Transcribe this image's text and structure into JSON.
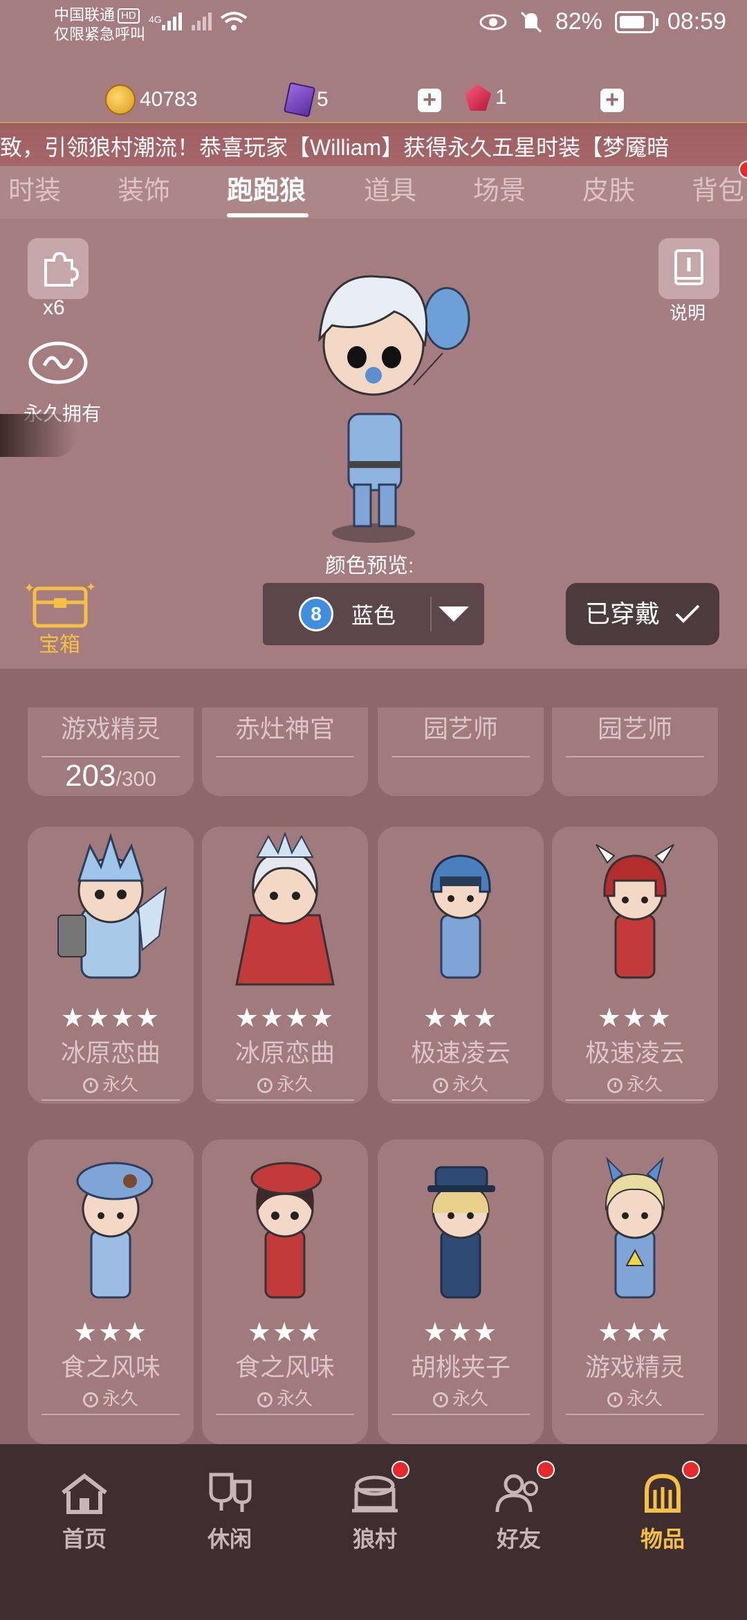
{
  "status_bar": {
    "carrier": "中国联通",
    "hd": "HD",
    "network": "4G",
    "emergency": "仅限紧急呼叫",
    "battery": "82%",
    "time": "08:59"
  },
  "currency": {
    "coins": "40783",
    "tickets": "5",
    "gems": "1"
  },
  "marquee": "致，引领狼村潮流！恭喜玩家【William】获得永久五星时装【梦魇暗",
  "tabs": [
    "时装",
    "装饰",
    "跑跑狼",
    "道具",
    "场景",
    "皮肤",
    "背包"
  ],
  "active_tab": "跑跑狼",
  "preview": {
    "fragments_count": "x6",
    "ownership": "永久拥有",
    "info_label": "说明",
    "color_preview_label": "颜色预览:",
    "color_number": "8",
    "color_name": "蓝色",
    "worn_label": "已穿戴",
    "chest_label": "宝箱"
  },
  "top_cards": [
    {
      "name": "游戏精灵",
      "progress": "203",
      "progress_total": "/300"
    },
    {
      "name": "赤灶神官"
    },
    {
      "name": "园艺师"
    },
    {
      "name": "园艺师"
    }
  ],
  "cards_row1": [
    {
      "name": "冰原恋曲",
      "stars": "★★★★",
      "duration": "永久"
    },
    {
      "name": "冰原恋曲",
      "stars": "★★★★",
      "duration": "永久"
    },
    {
      "name": "极速凌云",
      "stars": "★★★",
      "duration": "永久"
    },
    {
      "name": "极速凌云",
      "stars": "★★★",
      "duration": "永久"
    }
  ],
  "cards_row2": [
    {
      "name": "食之风味",
      "stars": "★★★",
      "duration": "永久"
    },
    {
      "name": "食之风味",
      "stars": "★★★",
      "duration": "永久"
    },
    {
      "name": "胡桃夹子",
      "stars": "★★★",
      "duration": "永久"
    },
    {
      "name": "游戏精灵",
      "stars": "★★★",
      "duration": "永久"
    }
  ],
  "bottom_nav": [
    {
      "label": "首页",
      "icon": "home-icon"
    },
    {
      "label": "休闲",
      "icon": "leisure-icon"
    },
    {
      "label": "狼村",
      "icon": "village-icon"
    },
    {
      "label": "好友",
      "icon": "friends-icon"
    },
    {
      "label": "物品",
      "icon": "items-icon"
    }
  ],
  "colors": {
    "background": "#a57d80",
    "accent_gold": "#f5c043",
    "nav_bg": "#3f2e2f",
    "badge_red": "#e8292b"
  }
}
